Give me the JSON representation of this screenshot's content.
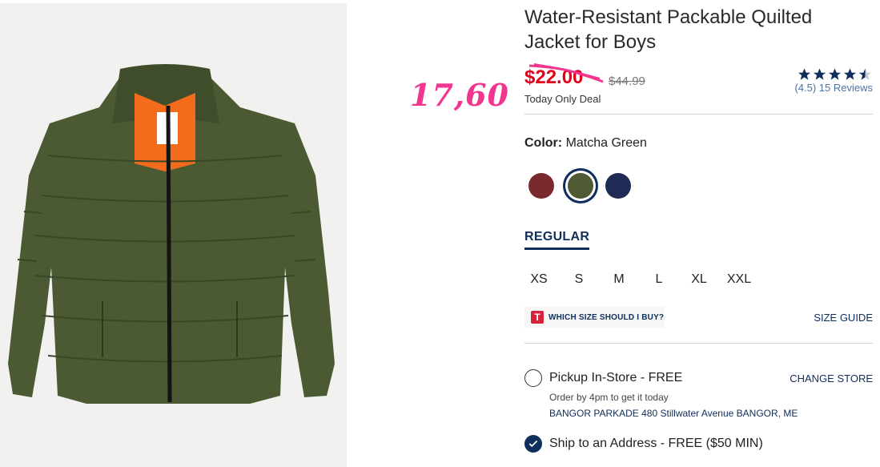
{
  "product": {
    "title": "Water-Resistant Packable Quilted Jacket for Boys",
    "sale_price": "$22.00",
    "original_price": "$44.99",
    "deal_text": "Today Only Deal",
    "handwritten_note": "17,60",
    "rating": 4.5,
    "rating_text": "(4.5) 15 Reviews",
    "colors": {
      "sale_price": "#e2001a",
      "accent": "#0f2e5b",
      "note": "#f0368f"
    }
  },
  "color_selector": {
    "label": "Color:",
    "selected_name": "Matcha Green",
    "swatches": [
      {
        "name": "burgundy",
        "color": "#7a2a2e",
        "selected": false
      },
      {
        "name": "matcha-green",
        "color": "#4f5a34",
        "selected": true
      },
      {
        "name": "navy",
        "color": "#1f2a55",
        "selected": false
      }
    ]
  },
  "fit": {
    "tab_label": "REGULAR"
  },
  "sizes": [
    "XS",
    "S",
    "M",
    "L",
    "XL",
    "XXL"
  ],
  "size_help": {
    "badge": "T",
    "label": "WHICH SIZE SHOULD I BUY?",
    "guide_link": "SIZE GUIDE"
  },
  "pickup": {
    "label": "Pickup In-Store - FREE",
    "change_store": "CHANGE STORE",
    "order_note": "Order by 4pm to get it today",
    "store_address": "BANGOR PARKADE 480 Stillwater Avenue  BANGOR, ME"
  },
  "ship": {
    "label": "Ship to an Address - FREE ($50 MIN)"
  },
  "icons": {
    "star": "star-icon",
    "check": "check-icon",
    "radio": "radio-icon"
  }
}
